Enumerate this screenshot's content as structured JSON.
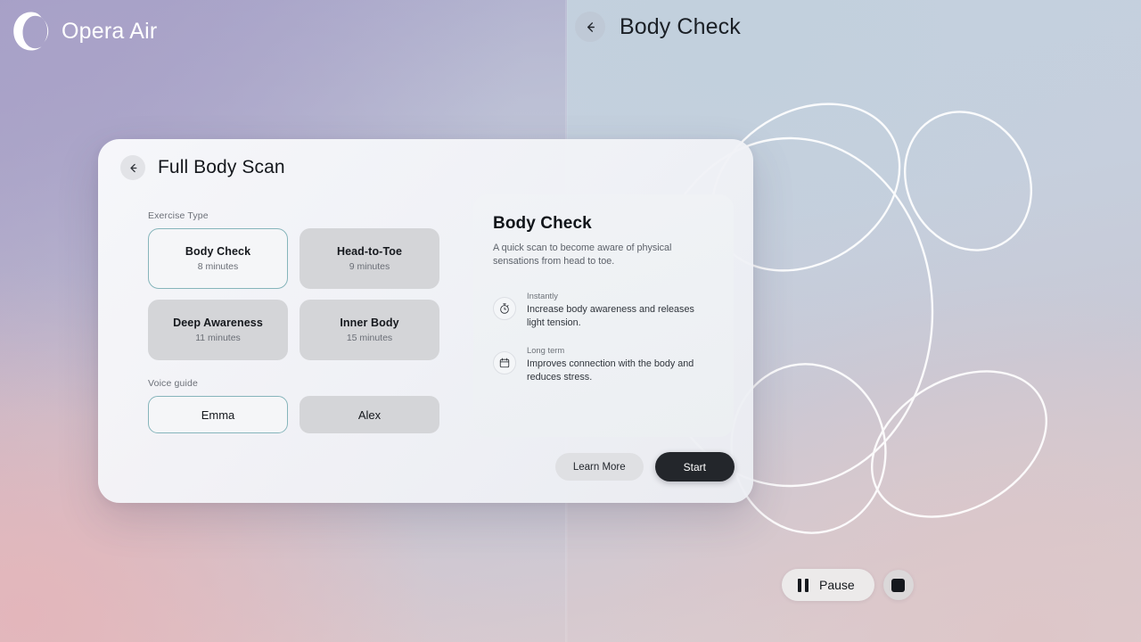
{
  "brand": {
    "name": "Opera Air",
    "logo_icon": "opera-o-logo-icon",
    "logo_color": "#ffffff"
  },
  "right_panel": {
    "back_icon": "arrow-left-icon",
    "title": "Body Check",
    "decoration": "overlapping-circle-outlines"
  },
  "dialog": {
    "back_icon": "arrow-left-icon",
    "title": "Full Body Scan",
    "exercise_section_label": "Exercise Type",
    "exercises": [
      {
        "name": "Body Check",
        "duration": "8 minutes",
        "selected": true
      },
      {
        "name": "Head-to-Toe",
        "duration": "9 minutes",
        "selected": false
      },
      {
        "name": "Deep Awareness",
        "duration": "11 minutes",
        "selected": false
      },
      {
        "name": "Inner Body",
        "duration": "15 minutes",
        "selected": false
      }
    ],
    "voice_section_label": "Voice guide",
    "voices": [
      {
        "name": "Emma",
        "selected": true
      },
      {
        "name": "Alex",
        "selected": false
      }
    ],
    "detail": {
      "title": "Body Check",
      "description": "A quick scan to become aware of physical sensations from head to toe.",
      "benefits": [
        {
          "icon": "stopwatch-icon",
          "kicker": "Instantly",
          "text": "Increase body awareness and releases light tension."
        },
        {
          "icon": "calendar-icon",
          "kicker": "Long term",
          "text": "Improves connection with the body and reduces stress."
        }
      ]
    },
    "actions": {
      "secondary_label": "Learn More",
      "primary_label": "Start"
    }
  },
  "playback": {
    "pause_label": "Pause",
    "pause_icon": "pause-icon",
    "stop_icon": "stop-icon"
  },
  "colors": {
    "selected_border": "#86b5bb",
    "primary_button_bg": "#23262b",
    "card_bg": "#d4d5d8",
    "selected_card_bg": "#f5f6f8"
  }
}
